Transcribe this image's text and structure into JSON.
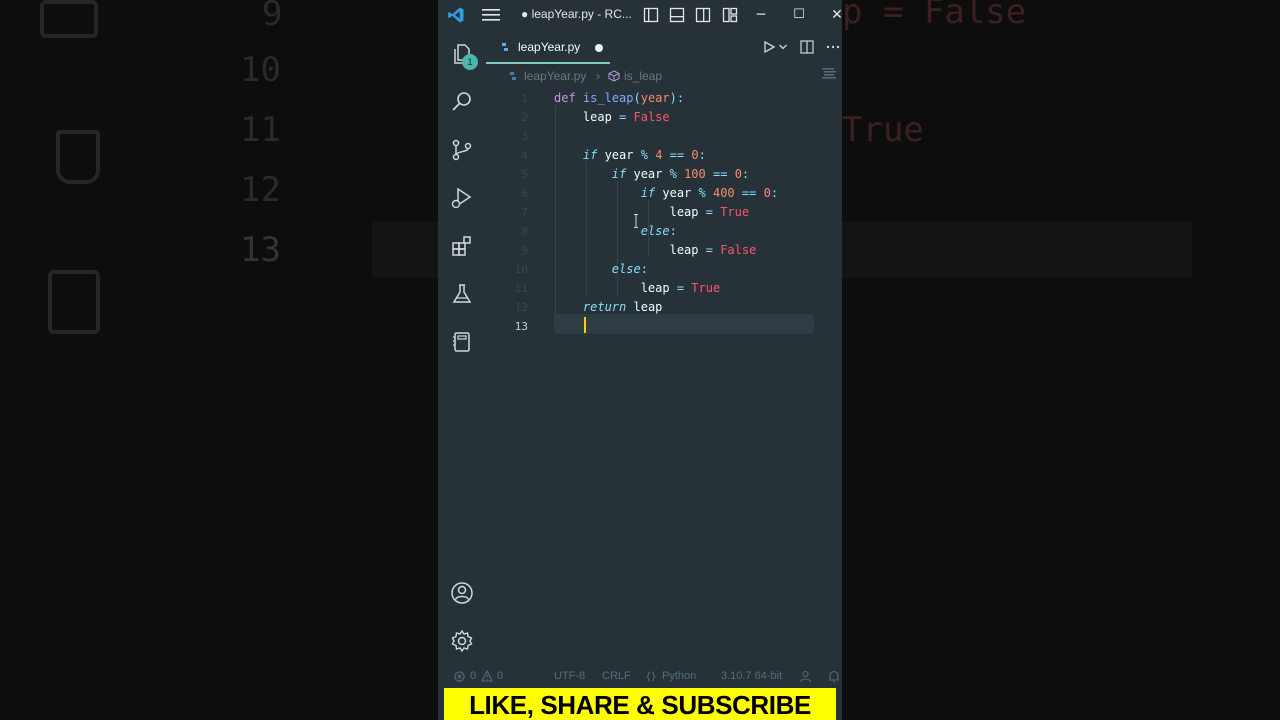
{
  "background": {
    "ghost_text": [
      "9",
      "10",
      "11",
      "12",
      "13"
    ],
    "ghost_code": [
      "p = False",
      "True"
    ]
  },
  "titlebar": {
    "title": "● leapYear.py - RC...",
    "minimize": "─",
    "maximize": "☐",
    "close": "✕"
  },
  "activity_bar": {
    "explorer_badge": "1"
  },
  "tab": {
    "label": "leapYear.py"
  },
  "breadcrumb": {
    "file": "leapYear.py",
    "separator": "›",
    "symbol": "is_leap"
  },
  "editor": {
    "line_numbers": [
      "1",
      "2",
      "3",
      "4",
      "5",
      "6",
      "7",
      "8",
      "9",
      "10",
      "11",
      "12",
      "13"
    ],
    "lines": [
      [
        {
          "t": "def",
          "c": "kd"
        },
        {
          "t": " "
        },
        {
          "t": "is_leap",
          "c": "fn"
        },
        {
          "t": "(",
          "c": "pn"
        },
        {
          "t": "year",
          "c": "pr"
        },
        {
          "t": "):",
          "c": "pn"
        }
      ],
      [
        {
          "t": "    leap "
        },
        {
          "t": "=",
          "c": "op"
        },
        {
          "t": " "
        },
        {
          "t": "False",
          "c": "bool"
        }
      ],
      [],
      [
        {
          "t": "    "
        },
        {
          "t": "if",
          "c": "k"
        },
        {
          "t": " year "
        },
        {
          "t": "%",
          "c": "op"
        },
        {
          "t": " "
        },
        {
          "t": "4",
          "c": "num"
        },
        {
          "t": " "
        },
        {
          "t": "==",
          "c": "op"
        },
        {
          "t": " "
        },
        {
          "t": "0",
          "c": "num"
        },
        {
          "t": ":",
          "c": "pn"
        }
      ],
      [
        {
          "t": "        "
        },
        {
          "t": "if",
          "c": "k"
        },
        {
          "t": " year "
        },
        {
          "t": "%",
          "c": "op"
        },
        {
          "t": " "
        },
        {
          "t": "100",
          "c": "num"
        },
        {
          "t": " "
        },
        {
          "t": "==",
          "c": "op"
        },
        {
          "t": " "
        },
        {
          "t": "0",
          "c": "num"
        },
        {
          "t": ":",
          "c": "pn"
        }
      ],
      [
        {
          "t": "            "
        },
        {
          "t": "if",
          "c": "k"
        },
        {
          "t": " year "
        },
        {
          "t": "%",
          "c": "op"
        },
        {
          "t": " "
        },
        {
          "t": "400",
          "c": "num"
        },
        {
          "t": " "
        },
        {
          "t": "==",
          "c": "op"
        },
        {
          "t": " "
        },
        {
          "t": "0",
          "c": "num"
        },
        {
          "t": ":",
          "c": "pn"
        }
      ],
      [
        {
          "t": "                leap "
        },
        {
          "t": "=",
          "c": "op"
        },
        {
          "t": " "
        },
        {
          "t": "True",
          "c": "bool"
        }
      ],
      [
        {
          "t": "            "
        },
        {
          "t": "else",
          "c": "k"
        },
        {
          "t": ":",
          "c": "pn"
        }
      ],
      [
        {
          "t": "                leap "
        },
        {
          "t": "=",
          "c": "op"
        },
        {
          "t": " "
        },
        {
          "t": "False",
          "c": "bool"
        }
      ],
      [
        {
          "t": "        "
        },
        {
          "t": "else",
          "c": "k"
        },
        {
          "t": ":",
          "c": "pn"
        }
      ],
      [
        {
          "t": "            leap "
        },
        {
          "t": "=",
          "c": "op"
        },
        {
          "t": " "
        },
        {
          "t": "True",
          "c": "bool"
        }
      ],
      [
        {
          "t": "    "
        },
        {
          "t": "return",
          "c": "k"
        },
        {
          "t": " leap"
        }
      ],
      []
    ],
    "active_line": 13
  },
  "statusbar": {
    "errors": "0",
    "warnings": "0",
    "encoding": "UTF-8",
    "eol": "CRLF",
    "language": "Python",
    "interpreter": "3.10.7 64-bit"
  },
  "banner": {
    "text": "LIKE, SHARE & SUBSCRIBE"
  },
  "colors": {
    "editor_bg": "#263238",
    "accent": "#80cbc4",
    "caret": "#ffcc00",
    "banner": "#ffff00"
  }
}
